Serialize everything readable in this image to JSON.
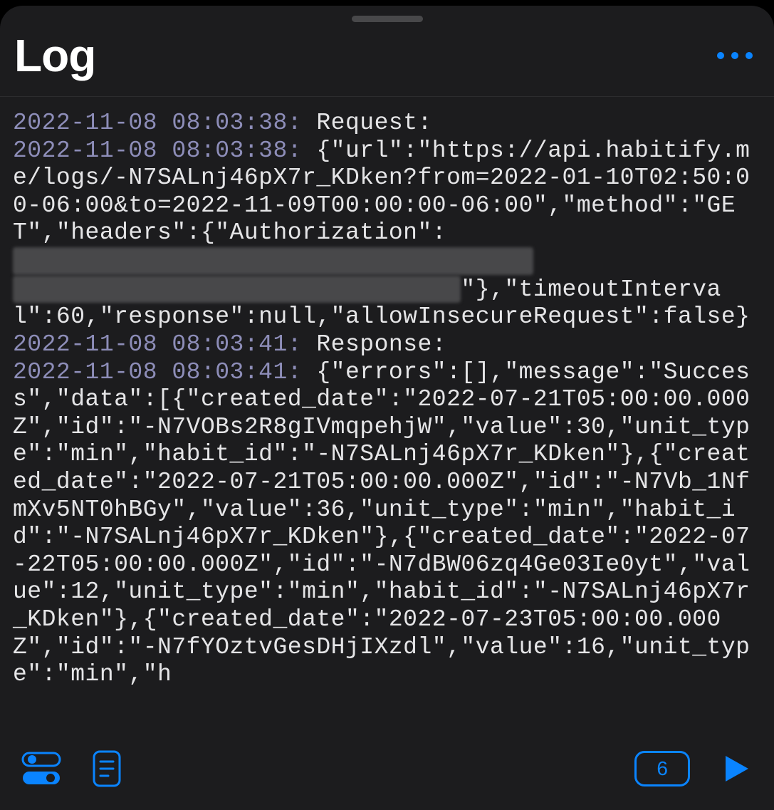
{
  "header": {
    "title": "Log"
  },
  "log_lines": [
    {
      "timestamp": "2022-11-08 08:03:38:",
      "text": " Request:"
    },
    {
      "timestamp": "2022-11-08 08:03:38:",
      "text": " {\"url\":\"https://api.habitify.me/logs/-N7SALnj46pX7r_KDken?from=2022-01-10T02:50:00-06:00&to=2022-11-09T00:00:00-06:00\",\"method\":\"GET\",\"headers\":{\"Authorization\":",
      "redacted1": "xxxxxxxxxxxxxxxxxxxxxxxxxxxxxxxxxxxx",
      "redacted2": "xxxxxxxxxxxxxxxxxxxxxxxxxxxxxxx",
      "text2": "\"},\"timeoutInterval\":60,\"response\":null,\"allowInsecureRequest\":false}"
    },
    {
      "timestamp": "2022-11-08 08:03:41:",
      "text": " Response:"
    },
    {
      "timestamp": "2022-11-08 08:03:41:",
      "text": " {\"errors\":[],\"message\":\"Success\",\"data\":[{\"created_date\":\"2022-07-21T05:00:00.000Z\",\"id\":\"-N7VOBs2R8gIVmqpehjW\",\"value\":30,\"unit_type\":\"min\",\"habit_id\":\"-N7SALnj46pX7r_KDken\"},{\"created_date\":\"2022-07-21T05:00:00.000Z\",\"id\":\"-N7Vb_1NfmXv5NT0hBGy\",\"value\":36,\"unit_type\":\"min\",\"habit_id\":\"-N7SALnj46pX7r_KDken\"},{\"created_date\":\"2022-07-22T05:00:00.000Z\",\"id\":\"-N7dBW06zq4Ge03Ie0yt\",\"value\":12,\"unit_type\":\"min\",\"habit_id\":\"-N7SALnj46pX7r_KDken\"},{\"created_date\":\"2022-07-23T05:00:00.000Z\",\"id\":\"-N7fYOztvGesDHjIXzdl\",\"value\":16,\"unit_type\":\"min\",\"h"
    }
  ],
  "toolbar": {
    "badge_count": "6"
  }
}
